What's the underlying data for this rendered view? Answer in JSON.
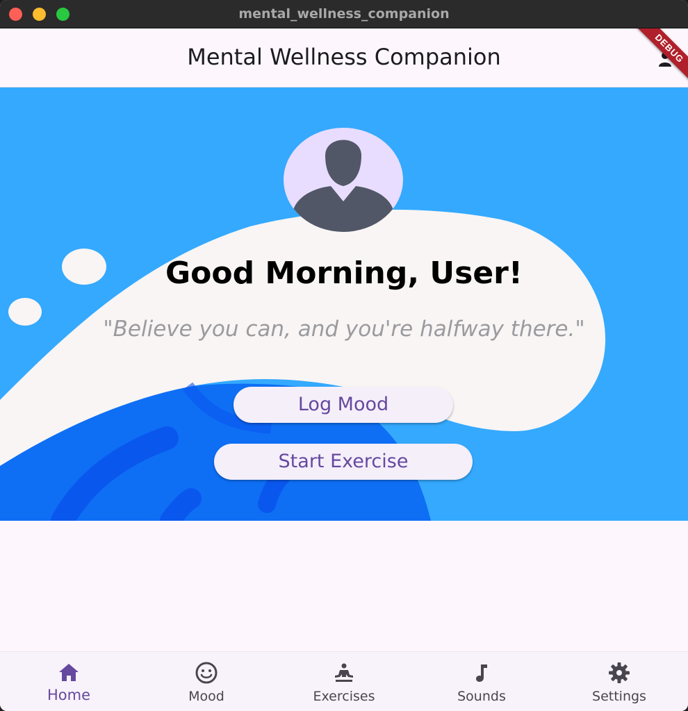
{
  "window": {
    "title": "mental_wellness_companion"
  },
  "appbar": {
    "title": "Mental Wellness Companion",
    "debug_banner": "DEBUG"
  },
  "hero": {
    "greeting": "Good Morning, User!",
    "quote": "\"Believe you can, and you're halfway there.\"",
    "buttons": {
      "log_mood": "Log Mood",
      "start_exercise": "Start Exercise"
    }
  },
  "bottom_nav": {
    "selected": "Home",
    "items": [
      {
        "label": "Home",
        "icon": "home-icon"
      },
      {
        "label": "Mood",
        "icon": "smiley-icon"
      },
      {
        "label": "Exercises",
        "icon": "meditation-icon"
      },
      {
        "label": "Sounds",
        "icon": "music-note-icon"
      },
      {
        "label": "Settings",
        "icon": "gear-icon"
      }
    ]
  },
  "colors": {
    "accent": "#65499f",
    "hero_sky": "#34a9fe",
    "hero_wave": "#f8f5f4",
    "hero_deep": "#0e6ff5",
    "avatar_bg": "#e8ddff"
  }
}
